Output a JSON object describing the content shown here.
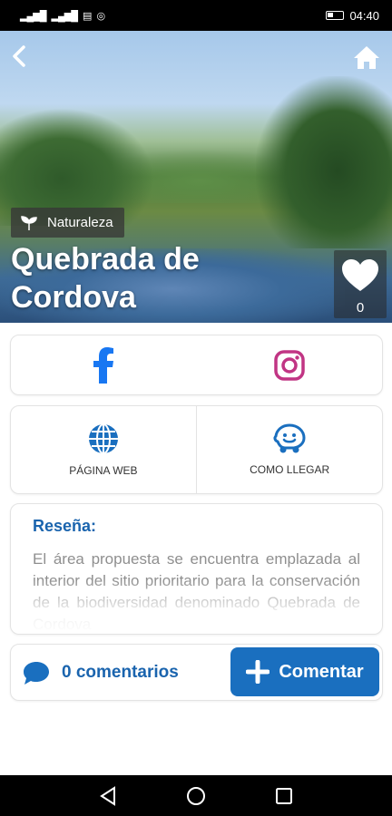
{
  "status_bar": {
    "time": "04:40",
    "signal_glyph": "⁴ᴳ",
    "icons": [
      "signal-icon",
      "wifi-icon",
      "whatsapp-icon",
      "battery-icon"
    ]
  },
  "header": {
    "back_icon": "chevron-left-icon",
    "home_icon": "home-icon"
  },
  "place": {
    "category": "Naturaleza",
    "title": "Quebrada de Cordova",
    "likes": "0"
  },
  "social": {
    "facebook_color": "#1877f2",
    "instagram_color": "#c13584"
  },
  "links": {
    "website_label": "PÁGINA WEB",
    "directions_label": "COMO LLEGAR"
  },
  "review": {
    "heading": "Reseña:",
    "text": "El área propuesta se encuentra emplazada al interior del sitio prioritario para la conservación de la biodiversidad denominado Quebrada de Cordova"
  },
  "comments": {
    "count_label": "0 comentarios",
    "button_label": "Comentar"
  },
  "colors": {
    "accent": "#1a64ae",
    "button": "#1a6fbf"
  }
}
